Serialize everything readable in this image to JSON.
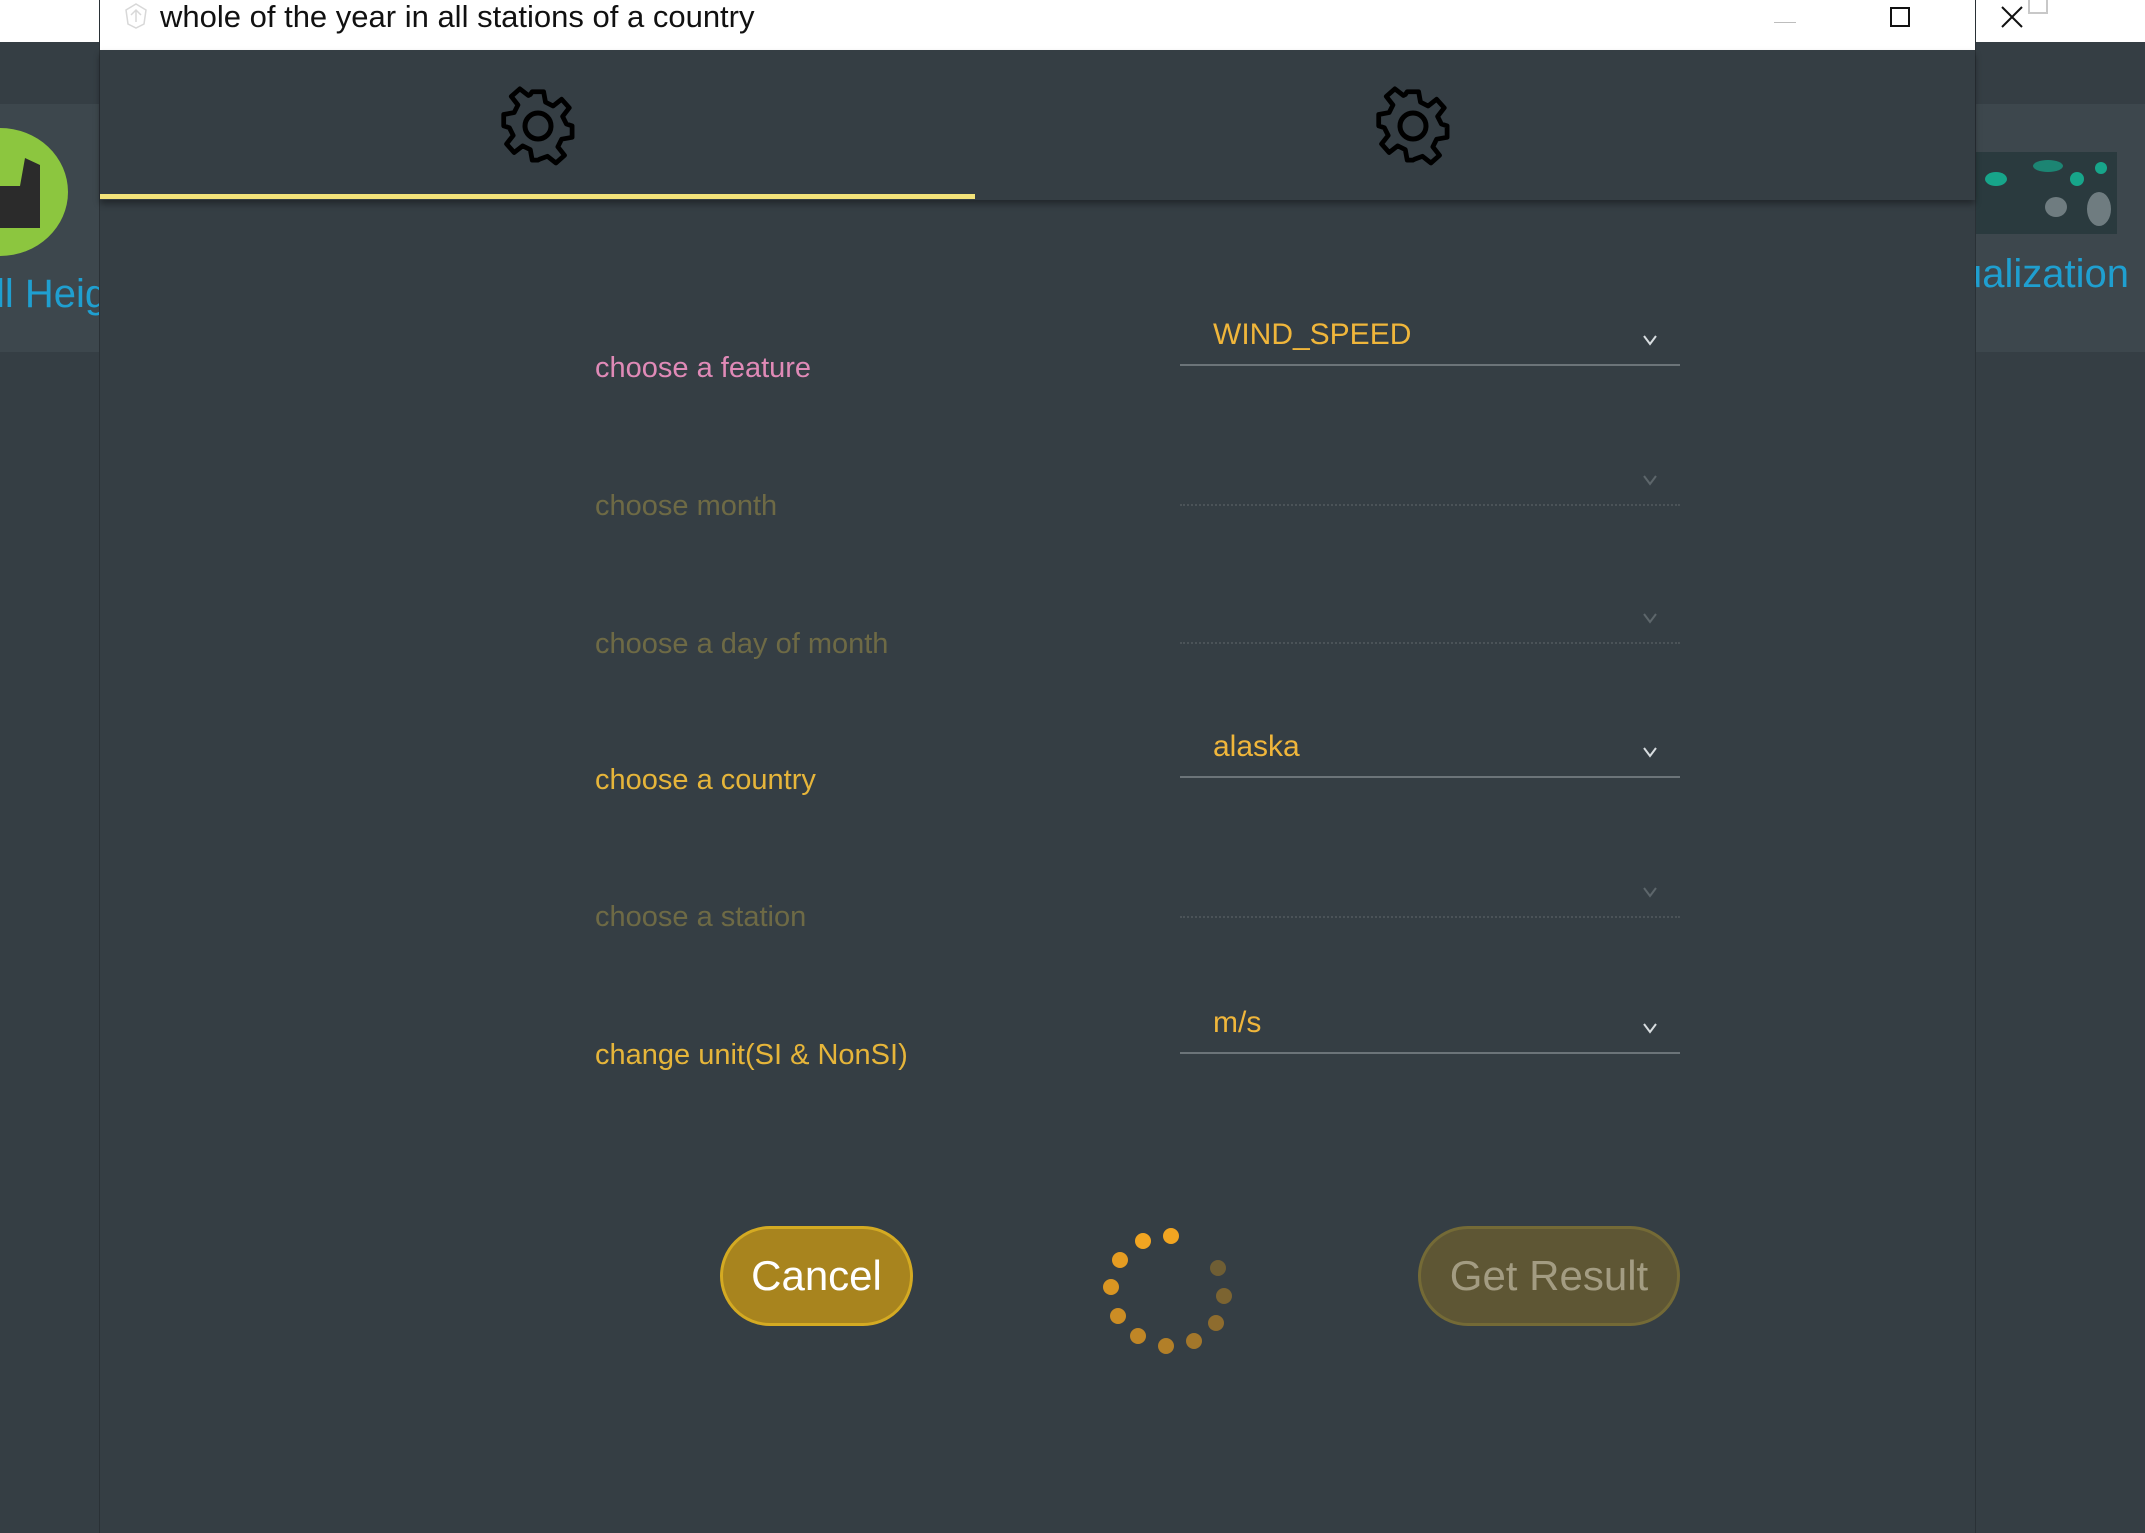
{
  "background": {
    "left_card_label": "ll Heig",
    "right_card_label": "ualization"
  },
  "dialog": {
    "title": "whole of the year in all stations of a country",
    "window_controls": {
      "minimize_icon": "minimize-icon",
      "maximize_icon": "maximize-icon",
      "close_icon": "close-icon"
    },
    "tabs": [
      {
        "icon": "gear-icon",
        "selected": true
      },
      {
        "icon": "gear-icon",
        "selected": false
      }
    ],
    "accent_color": "#f3e37a"
  },
  "form": {
    "feature": {
      "label": "choose a feature",
      "value": "WIND_SPEED",
      "enabled": true
    },
    "month": {
      "label": "choose month",
      "value": "",
      "enabled": false
    },
    "day_of_month": {
      "label": "choose a day of month",
      "value": "",
      "enabled": false
    },
    "country": {
      "label": "choose a country",
      "value": "alaska",
      "enabled": true
    },
    "station": {
      "label": "choose a station",
      "value": "",
      "enabled": false
    },
    "unit": {
      "label": "change unit(SI & NonSI)",
      "value": "m/s",
      "enabled": true
    }
  },
  "actions": {
    "cancel_label": "Cancel",
    "get_result_label": "Get Result",
    "get_result_enabled": false,
    "loading_indicator": "spinner-icon"
  },
  "colors": {
    "label_pink": "#e08ab7",
    "label_yellow": "#e6b53a",
    "value_orange": "#f0b63b",
    "cancel_button": "#a8841e"
  }
}
